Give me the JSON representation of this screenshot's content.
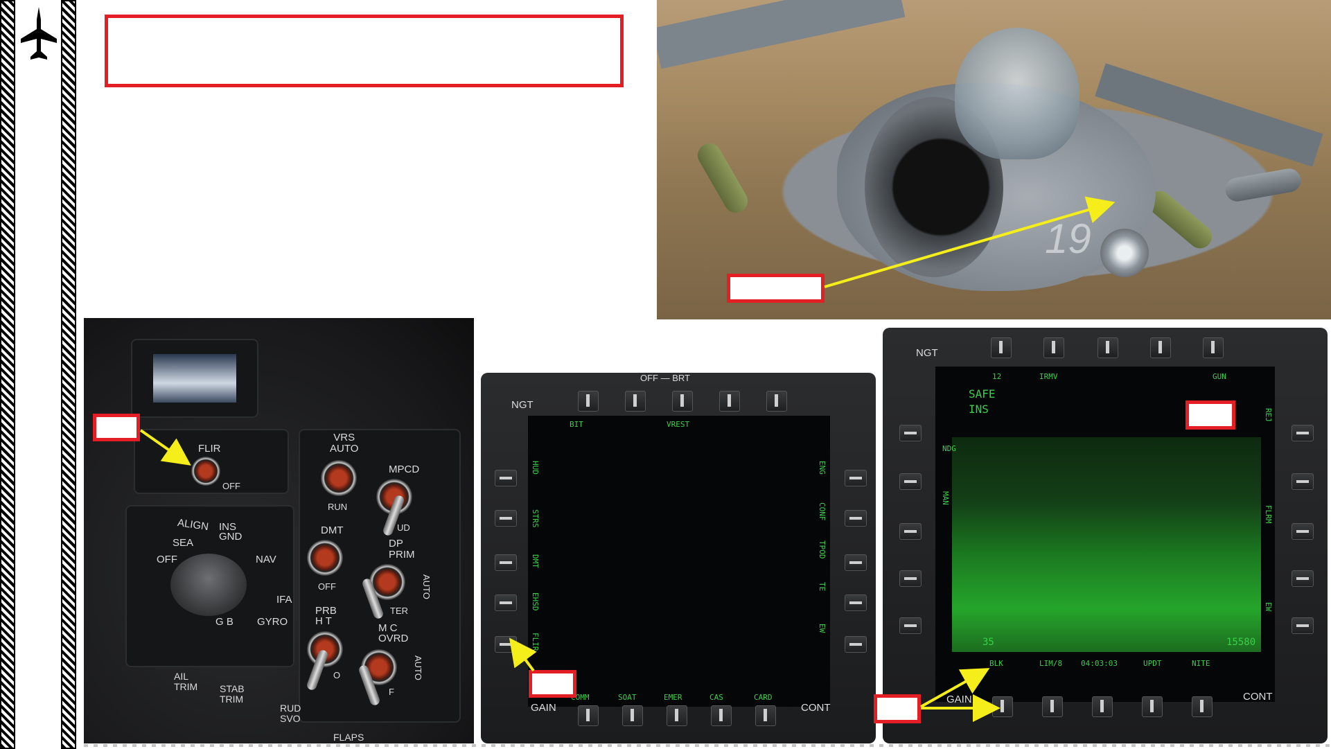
{
  "title_box": {
    "text": ""
  },
  "label_boxes": {
    "nose": "",
    "flir_switch": "",
    "flir_osb": "",
    "cont_osb": "",
    "gain": "",
    "panel": ""
  },
  "panel": {
    "labels": {
      "flir": "FLIR",
      "off": "OFF",
      "vrs_auto": "VRS\nAUTO",
      "run": "RUN",
      "mpcd": "MPCD",
      "ud": "UD",
      "dmt": "DMT",
      "dmt_off": "OFF",
      "dp_prim": "DP\nPRIM",
      "auto": "AUTO",
      "ter": "TER",
      "prb_ht": "PRB\nH T",
      "o": "O",
      "mc_ovrd": "M C\nOVRD",
      "f": "F",
      "align": "ALIGN",
      "ins_gnd": "INS\nGND",
      "sea": "SEA",
      "off2": "OFF",
      "nav": "NAV",
      "ifa": "IFA",
      "gb": "G B",
      "gyro": "GYRO",
      "ail_trim": "AIL\nTRIM",
      "stab_trim": "STAB\nTRIM",
      "rud_svo": "RUD\nSVO",
      "flaps": "FLAPS",
      "auto2": "AUTO"
    }
  },
  "mfd_left": {
    "ngt": "NGT",
    "gain": "GAIN",
    "cont": "CONT",
    "top_text": "OFF — BRT",
    "top_labels": [
      "BIT",
      "VREST"
    ],
    "left_labels": [
      "HUD",
      "STRS",
      "DMT",
      "EHSD",
      "FLIR"
    ],
    "right_labels": [
      "ENG",
      "CONF",
      "TPOD",
      "TE",
      "EW"
    ],
    "bottom_labels": [
      "COMM",
      "SOAT",
      "EMER",
      "CAS",
      "CARD"
    ]
  },
  "mfd_right": {
    "ngt": "NGT",
    "gain": "GAIN",
    "cont": "CONT",
    "top_labels": [
      "12",
      "IRMV",
      "GUN"
    ],
    "status": [
      "SAFE",
      "INS"
    ],
    "left_labels": [
      "NDG",
      "MAN"
    ],
    "right_labels": [
      "REJ",
      "FLRM",
      "EW"
    ],
    "bottom_labels": [
      "BLK",
      "LIM/8",
      "04:03:03",
      "UPDT",
      "NITE"
    ],
    "readout_left": "35",
    "readout_right": "15580"
  },
  "colors": {
    "accent_red": "#e41e25",
    "arrow_yellow": "#f5ee1a",
    "mfd_green": "#3bd04a"
  }
}
